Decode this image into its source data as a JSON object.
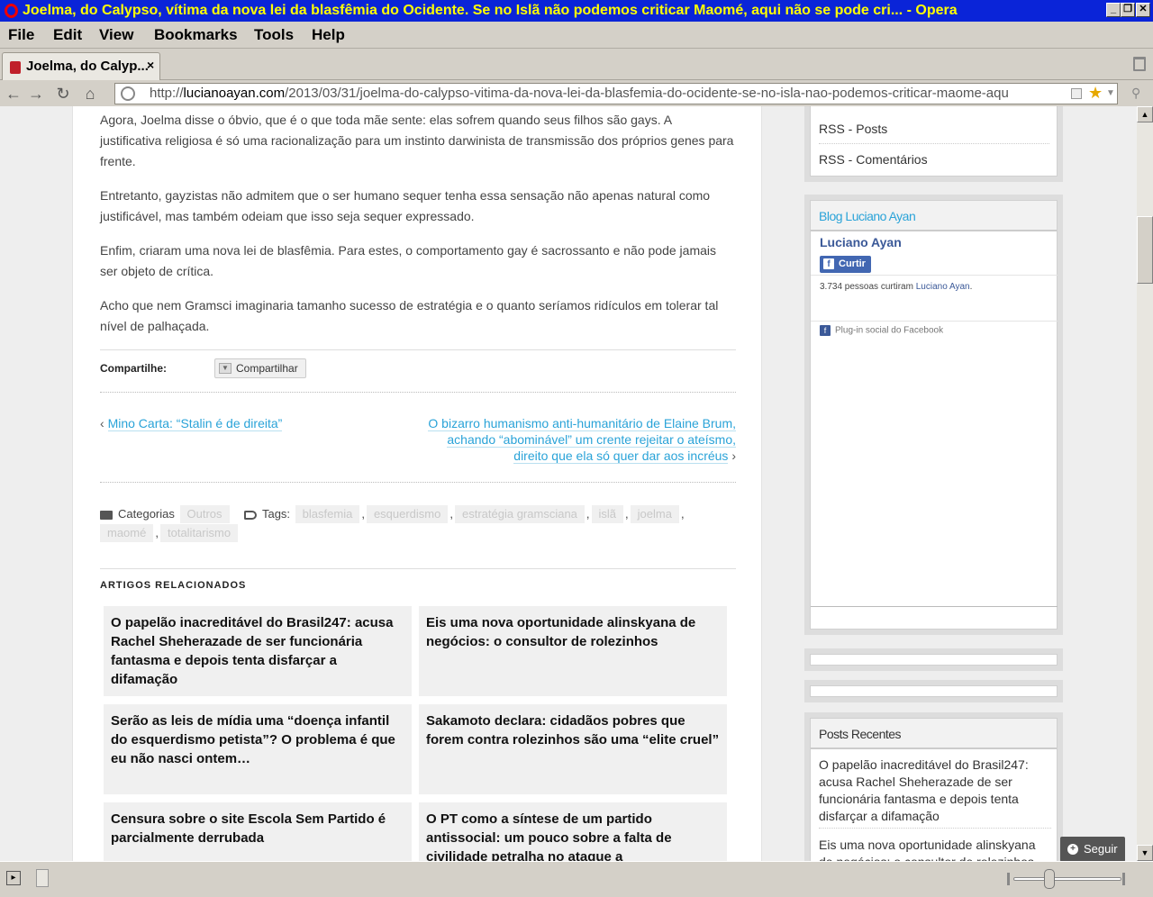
{
  "window": {
    "title": "Joelma, do Calypso, vítima da nova lei da blasfêmia do Ocidente. Se no Islã não podemos criticar Maomé, aqui não se pode cri... - Opera",
    "controls": [
      "_",
      "❐",
      "✕"
    ]
  },
  "menu": [
    "File",
    "Edit",
    "View",
    "Bookmarks",
    "Tools",
    "Help"
  ],
  "tab": {
    "title": "Joelma, do Calyp...",
    "close": "×"
  },
  "address": {
    "prefix": "http://",
    "domain": "lucianoayan.com",
    "path": "/2013/03/31/joelma-do-calypso-vitima-da-nova-lei-da-blasfemia-do-ocidente-se-no-isla-nao-podemos-criticar-maome-aqu"
  },
  "article": {
    "paragraphs": [
      "Agora, Joelma disse o óbvio, que é o que toda mãe sente: elas sofrem quando seus filhos são gays. A justificativa religiosa é só uma racionalização para um instinto darwinista de transmissão dos próprios genes para frente.",
      "Entretanto, gayzistas não admitem que o ser humano sequer tenha essa sensação não apenas natural como justificável, mas também odeiam que isso seja sequer expressado.",
      "Enfim, criaram uma nova lei de blasfêmia. Para estes, o comportamento gay é sacrossanto e não pode jamais ser objeto de crítica.",
      "Acho que nem Gramsci imaginaria tamanho sucesso de estratégia e o quanto seríamos ridículos em tolerar tal nível de palhaçada."
    ],
    "share_label": "Compartilhe:",
    "share_button": "Compartilhar",
    "prev_link": "Mino Carta: “Stalin é de direita”",
    "prev_arrow": "‹",
    "next_link_lines": [
      "O bizarro humanismo anti-humanitário de Elaine Brum,",
      "achando “abominável” um crente rejeitar o ateísmo,",
      "direito que ela só quer dar aos incréus"
    ],
    "next_arrow": "›",
    "categories_label": "Categorias",
    "categories": [
      "Outros"
    ],
    "tags_label": "Tags:",
    "tags": [
      "blasfemia",
      "esquerdismo",
      "estratégia gramsciana",
      "islã",
      "joelma",
      "maomé",
      "totalitarismo"
    ],
    "related_heading": "ARTIGOS RELACIONADOS",
    "related": [
      "O papelão inacreditável do Brasil247: acusa Rachel Sheherazade de ser funcionária fantasma e depois tenta disfarçar a difamação",
      "Eis uma nova oportunidade alinskyana de negócios: o consultor de rolezinhos",
      "Serão as leis de mídia uma “doença infantil do esquerdismo petista”? O problema é que eu não nasci ontem…",
      "Sakamoto declara: cidadãos pobres que forem contra rolezinhos são uma “elite cruel”",
      "Censura sobre o site Escola Sem Partido é parcialmente derrubada",
      "O PT como a síntese de um partido antissocial: um pouco sobre a falta de civilidade petralha no ataque a"
    ]
  },
  "sidebar": {
    "rss": [
      "RSS - Posts",
      "RSS - Comentários"
    ],
    "fb_widget_title": "Blog Luciano Ayan",
    "fb_page_name": "Luciano Ayan",
    "fb_like": "Curtir",
    "fb_count_text": "3.734 pessoas curtiram",
    "fb_count_link": "Luciano Ayan",
    "fb_count_dot": ".",
    "fb_plugin": "Plug-in social do Facebook",
    "recent_title": "Posts Recentes",
    "recent": [
      "O papelão inacreditável do Brasil247: acusa Rachel Sheherazade de ser funcionária fantasma e depois tenta disfarçar a difamação",
      "Eis uma nova oportunidade alinskyana de negócios: o consultor de rolezinhos"
    ]
  },
  "follow_button": "Seguir",
  "colors": {
    "title_bg": "#0a24d8",
    "title_fg": "#ffff00",
    "link": "#2aa3d8",
    "facebook": "#3b5998"
  }
}
